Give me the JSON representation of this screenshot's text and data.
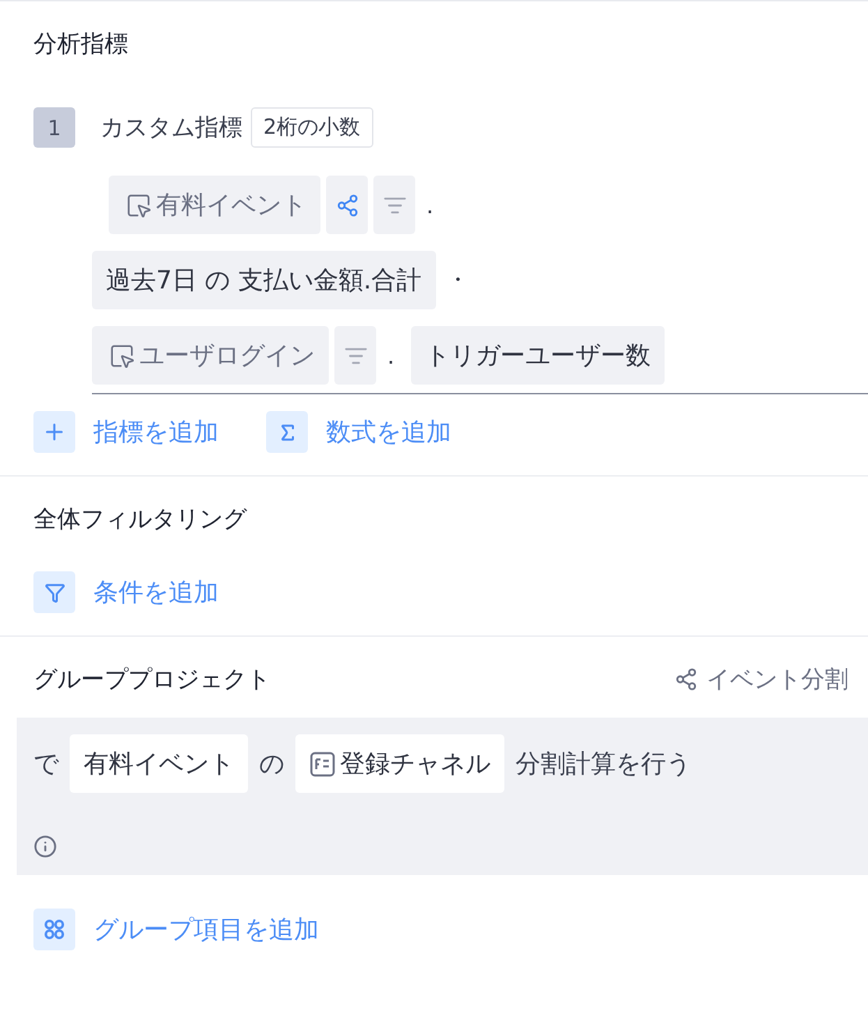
{
  "metrics": {
    "title": "分析指標",
    "items": [
      {
        "index": "1",
        "name": "カスタム指標",
        "format": "2桁の小数",
        "lines": [
          {
            "nested": true,
            "parts": [
              {
                "kind": "event",
                "text": "有料イベント"
              },
              {
                "kind": "split"
              },
              {
                "kind": "filter"
              },
              {
                "kind": "sep",
                "text": "."
              }
            ]
          },
          {
            "nested": false,
            "parts": [
              {
                "kind": "chip",
                "text": "過去7日 の 支払い金額.合計"
              },
              {
                "kind": "sep",
                "text": "・"
              }
            ]
          },
          {
            "nested": false,
            "parts": [
              {
                "kind": "event",
                "text": "ユーザログイン"
              },
              {
                "kind": "filter"
              },
              {
                "kind": "sep",
                "text": "."
              },
              {
                "kind": "chip",
                "text": "トリガーユーザー数"
              }
            ]
          }
        ]
      }
    ],
    "actions": [
      {
        "kind": "plus",
        "label": "指標を追加"
      },
      {
        "kind": "sigma",
        "label": "数式を追加"
      }
    ]
  },
  "filter": {
    "title": "全体フィルタリング",
    "actions": [
      {
        "kind": "funnel",
        "label": "条件を追加"
      }
    ]
  },
  "group": {
    "title": "グループプロジェクト",
    "split": "イベント分割",
    "sentence": [
      {
        "kind": "text",
        "text": "で"
      },
      {
        "kind": "chip",
        "text": "有料イベント"
      },
      {
        "kind": "text",
        "text": "の"
      },
      {
        "kind": "property",
        "text": "登録チャネル"
      },
      {
        "kind": "text",
        "text": "分割計算を行う"
      }
    ],
    "actions": [
      {
        "kind": "grid",
        "label": "グループ項目を追加"
      }
    ]
  }
}
